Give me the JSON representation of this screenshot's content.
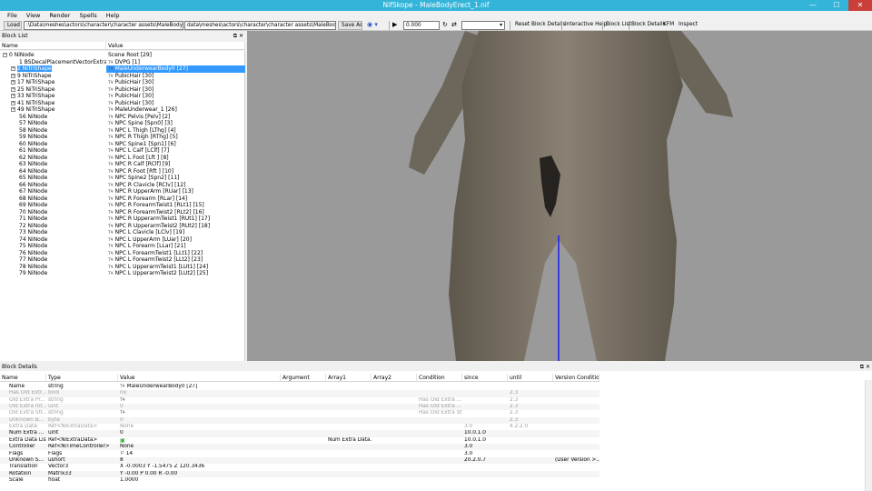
{
  "window": {
    "title": "NifSkope - MaleBodyErect_1.nif",
    "controls": {
      "minimize": "—",
      "maximize": "☐",
      "close": "✕"
    }
  },
  "menu": [
    "File",
    "View",
    "Render",
    "Spells",
    "Help"
  ],
  "toolbar": {
    "load_label": "Load",
    "load_path": ":\\Data\\meshes\\actors\\character\\character assets\\MaleBodyErect_1.nif",
    "save_path": "data\\meshes\\actors\\character\\character assets\\MaleBodyErect_1.nif",
    "save_as_label": "Save As",
    "time_value": "0.000",
    "reset_block_details": "Reset Block Details",
    "interactive_help": "Interactive Help",
    "block_list": "Block List",
    "block_details": "Block Details",
    "kfm": "KFM",
    "inspect": "Inspect"
  },
  "block_list": {
    "title": "Block List",
    "col_name": "Name",
    "col_value": "Value",
    "rows": [
      {
        "name": "0 NiNode",
        "value": "Scene Root [29]",
        "indent": 0,
        "expander": "⊟",
        "tw": false
      },
      {
        "name": "1 BSDecalPlacementVectorExtraData",
        "value": "DVPG [1]",
        "indent": 2,
        "expander": "",
        "tw": true
      },
      {
        "name": "2 NiTriShape",
        "value": "MaleUnderwearBody0 [27]",
        "indent": 1,
        "expander": "⊞",
        "tw": true,
        "selected": true
      },
      {
        "name": "9 NiTriShape",
        "value": "PubicHair [30]",
        "indent": 1,
        "expander": "⊞",
        "tw": true
      },
      {
        "name": "17 NiTriShape",
        "value": "PubicHair [30]",
        "indent": 1,
        "expander": "⊞",
        "tw": true
      },
      {
        "name": "25 NiTriShape",
        "value": "PubicHair [30]",
        "indent": 1,
        "expander": "⊞",
        "tw": true
      },
      {
        "name": "33 NiTriShape",
        "value": "PubicHair [30]",
        "indent": 1,
        "expander": "⊞",
        "tw": true
      },
      {
        "name": "41 NiTriShape",
        "value": "PubicHair [30]",
        "indent": 1,
        "expander": "⊞",
        "tw": true
      },
      {
        "name": "49 NiTriShape",
        "value": "MaleUnderwear_1 [26]",
        "indent": 1,
        "expander": "⊞",
        "tw": true
      },
      {
        "name": "56 NiNode",
        "value": "NPC Pelvis [Pelv] [2]",
        "indent": 2,
        "expander": "",
        "tw": true
      },
      {
        "name": "57 NiNode",
        "value": "NPC Spine [Spn0] [3]",
        "indent": 2,
        "expander": "",
        "tw": true
      },
      {
        "name": "58 NiNode",
        "value": "NPC L Thigh [LThg] [4]",
        "indent": 2,
        "expander": "",
        "tw": true
      },
      {
        "name": "59 NiNode",
        "value": "NPC R Thigh [RThg] [5]",
        "indent": 2,
        "expander": "",
        "tw": true
      },
      {
        "name": "60 NiNode",
        "value": "NPC Spine1 [Spn1] [6]",
        "indent": 2,
        "expander": "",
        "tw": true
      },
      {
        "name": "61 NiNode",
        "value": "NPC L Calf [LClf] [7]",
        "indent": 2,
        "expander": "",
        "tw": true
      },
      {
        "name": "62 NiNode",
        "value": "NPC L Foot [Lft ] [8]",
        "indent": 2,
        "expander": "",
        "tw": true
      },
      {
        "name": "63 NiNode",
        "value": "NPC R Calf [RClf] [9]",
        "indent": 2,
        "expander": "",
        "tw": true
      },
      {
        "name": "64 NiNode",
        "value": "NPC R Foot [Rft ] [10]",
        "indent": 2,
        "expander": "",
        "tw": true
      },
      {
        "name": "65 NiNode",
        "value": "NPC Spine2 [Spn2] [11]",
        "indent": 2,
        "expander": "",
        "tw": true
      },
      {
        "name": "66 NiNode",
        "value": "NPC R Clavicle [RClv] [12]",
        "indent": 2,
        "expander": "",
        "tw": true
      },
      {
        "name": "67 NiNode",
        "value": "NPC R UpperArm [RUar] [13]",
        "indent": 2,
        "expander": "",
        "tw": true
      },
      {
        "name": "68 NiNode",
        "value": "NPC R Forearm [RLar] [14]",
        "indent": 2,
        "expander": "",
        "tw": true
      },
      {
        "name": "69 NiNode",
        "value": "NPC R ForearmTwist1 [RLt1] [15]",
        "indent": 2,
        "expander": "",
        "tw": true
      },
      {
        "name": "70 NiNode",
        "value": "NPC R ForearmTwist2 [RLt2] [16]",
        "indent": 2,
        "expander": "",
        "tw": true
      },
      {
        "name": "71 NiNode",
        "value": "NPC R UpperarmTwist1 [RUt1] [17]",
        "indent": 2,
        "expander": "",
        "tw": true
      },
      {
        "name": "72 NiNode",
        "value": "NPC R UpperarmTwist2 [RUt2] [18]",
        "indent": 2,
        "expander": "",
        "tw": true
      },
      {
        "name": "73 NiNode",
        "value": "NPC L Clavicle [LClv] [19]",
        "indent": 2,
        "expander": "",
        "tw": true
      },
      {
        "name": "74 NiNode",
        "value": "NPC L UpperArm [LUar] [20]",
        "indent": 2,
        "expander": "",
        "tw": true
      },
      {
        "name": "75 NiNode",
        "value": "NPC L Forearm [LLar] [21]",
        "indent": 2,
        "expander": "",
        "tw": true
      },
      {
        "name": "76 NiNode",
        "value": "NPC L ForearmTwist1 [LLt1] [22]",
        "indent": 2,
        "expander": "",
        "tw": true
      },
      {
        "name": "77 NiNode",
        "value": "NPC L ForearmTwist2 [LLt2] [23]",
        "indent": 2,
        "expander": "",
        "tw": true
      },
      {
        "name": "78 NiNode",
        "value": "NPC L UpperarmTwist1 [LUt1] [24]",
        "indent": 2,
        "expander": "",
        "tw": true
      },
      {
        "name": "79 NiNode",
        "value": "NPC L UpperarmTwist2 [LUt2] [25]",
        "indent": 2,
        "expander": "",
        "tw": true
      }
    ]
  },
  "block_details": {
    "title": "Block Details",
    "columns": [
      "Name",
      "Type",
      "Value",
      "Argument",
      "Array1",
      "Array2",
      "Condition",
      "since",
      "until",
      "Version Condition"
    ],
    "rows": [
      {
        "name": "Name",
        "type": "string",
        "value": "MaleUnderwearBody0 [27]",
        "tw": true,
        "arg": "",
        "arr1": "",
        "arr2": "",
        "cond": "",
        "since": "",
        "until": "",
        "vcond": "",
        "grey": false
      },
      {
        "name": "Has Old Extr...",
        "type": "bool",
        "value": "no",
        "tw": false,
        "arg": "",
        "arr1": "",
        "arr2": "",
        "cond": "",
        "since": "",
        "until": "2.3",
        "vcond": "",
        "grey": true
      },
      {
        "name": "Old Extra Pr...",
        "type": "string",
        "value": "",
        "tw": true,
        "arg": "",
        "arr1": "",
        "arr2": "",
        "cond": "Has Old Extra ...",
        "since": "",
        "until": "2.3",
        "vcond": "",
        "grey": true
      },
      {
        "name": "Old Extra Int...",
        "type": "uint",
        "value": "0",
        "tw": false,
        "arg": "",
        "arr1": "",
        "arr2": "",
        "cond": "Has Old Extra ...",
        "since": "",
        "until": "2.3",
        "vcond": "",
        "grey": true
      },
      {
        "name": "Old Extra Str...",
        "type": "string",
        "value": "",
        "tw": true,
        "arg": "",
        "arr1": "",
        "arr2": "",
        "cond": "Has Old Extra Str...",
        "since": "",
        "until": "2.3",
        "vcond": "",
        "grey": true
      },
      {
        "name": "Unknown B...",
        "type": "byte",
        "value": "0",
        "tw": false,
        "arg": "",
        "arr1": "",
        "arr2": "",
        "cond": "",
        "since": "",
        "until": "2.3",
        "vcond": "",
        "grey": true
      },
      {
        "name": "Extra Data",
        "type": "Ref<NiExtraData>",
        "value": "None",
        "tw": false,
        "arg": "",
        "arr1": "",
        "arr2": "",
        "cond": "",
        "since": "3.0",
        "until": "4.2.2.0",
        "vcond": "",
        "grey": true
      },
      {
        "name": "Num Extra ...",
        "type": "uint",
        "value": "0",
        "tw": false,
        "arg": "",
        "arr1": "",
        "arr2": "",
        "cond": "",
        "since": "10.0.1.0",
        "until": "",
        "vcond": "",
        "grey": false
      },
      {
        "name": "Extra Data List",
        "type": "Ref<NiExtraData>",
        "value": "",
        "tw": false,
        "arg": "",
        "arr1": "Num Extra Data...",
        "arr2": "",
        "cond": "",
        "since": "10.0.1.0",
        "until": "",
        "vcond": "",
        "grey": false,
        "green_icon": true
      },
      {
        "name": "Controller",
        "type": "Ref<NiTimeController>",
        "value": "None",
        "tw": false,
        "arg": "",
        "arr1": "",
        "arr2": "",
        "cond": "",
        "since": "3.0",
        "until": "",
        "vcond": "",
        "grey": false
      },
      {
        "name": "Flags",
        "type": "Flags",
        "value": "14",
        "tw": false,
        "arg": "",
        "arr1": "",
        "arr2": "",
        "cond": "",
        "since": "3.0",
        "until": "",
        "vcond": "",
        "grey": false,
        "flag_icon": true
      },
      {
        "name": "Unknown S...",
        "type": "ushort",
        "value": "8",
        "tw": false,
        "arg": "",
        "arr1": "",
        "arr2": "",
        "cond": "",
        "since": "20.2.0.7",
        "until": "",
        "vcond": "(User Version >...",
        "grey": false
      },
      {
        "name": "Translation",
        "type": "Vector3",
        "value": "X -0.0003 Y -1.5475 Z 120.3436",
        "tw": false,
        "arg": "",
        "arr1": "",
        "arr2": "",
        "cond": "",
        "since": "",
        "until": "",
        "vcond": "",
        "grey": false
      },
      {
        "name": "Rotation",
        "type": "Matrix33",
        "value": "Y -0.00 P 0.00 R -0.00",
        "tw": false,
        "arg": "",
        "arr1": "",
        "arr2": "",
        "cond": "",
        "since": "",
        "until": "",
        "vcond": "",
        "grey": false
      },
      {
        "name": "Scale",
        "type": "float",
        "value": "1.0000",
        "tw": false,
        "arg": "",
        "arr1": "",
        "arr2": "",
        "cond": "",
        "since": "",
        "until": "",
        "vcond": "",
        "grey": false
      }
    ]
  },
  "colors": {
    "titlebar": "#33b4d8",
    "selection": "#3399ff",
    "viewport_bg": "#9a9a9a",
    "axis_line": "#1a1aff"
  }
}
